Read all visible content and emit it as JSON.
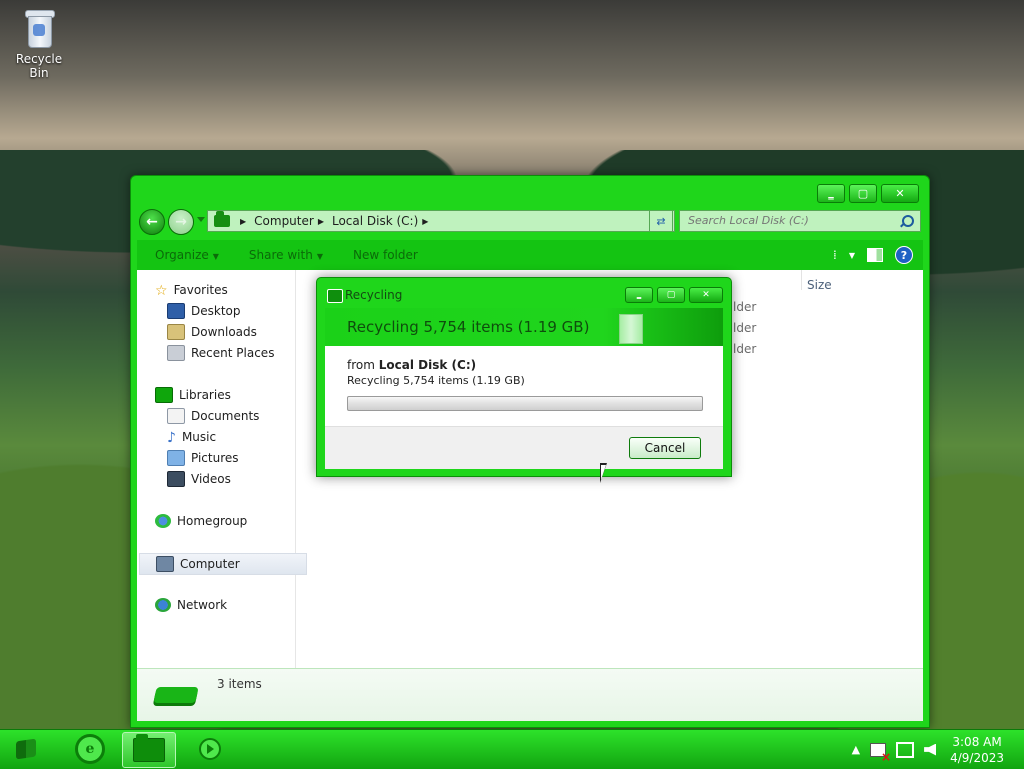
{
  "desktop": {
    "icons": [
      {
        "label": "Recycle Bin"
      }
    ]
  },
  "explorer": {
    "controls": {
      "minimize": "‗",
      "maximize": "▢",
      "close": "✕"
    },
    "address": {
      "segments": [
        "Computer",
        "Local Disk (C:)"
      ]
    },
    "search": {
      "placeholder": "Search Local Disk (C:)"
    },
    "toolbar": {
      "organize": "Organize",
      "share_with": "Share with",
      "new_folder": "New folder"
    },
    "nav": {
      "favorites": "Favorites",
      "favorites_items": [
        "Desktop",
        "Downloads",
        "Recent Places"
      ],
      "libraries": "Libraries",
      "libraries_items": [
        "Documents",
        "Music",
        "Pictures",
        "Videos"
      ],
      "homegroup": "Homegroup",
      "computer": "Computer",
      "network": "Network"
    },
    "columns": {
      "size": "Size"
    },
    "row_types": [
      "lder",
      "lder",
      "lder"
    ],
    "details": {
      "count": "3 items"
    }
  },
  "dialog": {
    "title": "Recycling",
    "header": "Recycling 5,754 items (1.19 GB)",
    "from_label": "from",
    "from_location": "Local Disk (C:)",
    "status": "Recycling 5,754 items (1.19 GB)",
    "progress": 0.0,
    "cancel": "Cancel"
  },
  "taskbar": {
    "clock_time": "3:08 AM",
    "clock_date": "4/9/2023",
    "tray_arrow": "▲"
  },
  "colors": {
    "accent": "#1fd61b",
    "accent_dark": "#0c8e0a"
  }
}
